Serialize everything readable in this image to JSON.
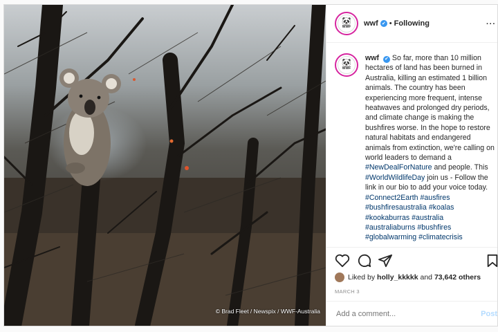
{
  "post": {
    "photo_credit": "© Brad Fleet / Newspix / WWF-Australia",
    "header": {
      "username": "wwf",
      "verified": "✔",
      "separator": "•",
      "follow_status": "Following",
      "more": "···",
      "avatar_logo": "WWF"
    },
    "caption": {
      "username": "wwf",
      "segments": [
        {
          "text": "So far, more than 10 million hectares of land has been burned in Australia, killing an estimated 1 billion animals. The country has been experiencing more frequent, intense heatwaves and prolonged dry periods, and climate change is making the bushfires worse. In the hope to restore natural habitats and endangered animals from extinction, we're calling on world leaders to demand a "
        },
        {
          "text": "#NewDealForNature",
          "tag": true
        },
        {
          "text": " and people. This "
        },
        {
          "text": "#WorldWildlifeDay",
          "tag": true
        },
        {
          "text": " join us - Follow the link in our bio to add your voice today. "
        },
        {
          "text": "#Connect2Earth",
          "tag": true
        },
        {
          "text": " "
        },
        {
          "text": "#ausfires",
          "tag": true
        },
        {
          "text": " "
        },
        {
          "text": "#bushfiresaustralia",
          "tag": true
        },
        {
          "text": " "
        },
        {
          "text": "#koalas",
          "tag": true
        },
        {
          "text": " "
        },
        {
          "text": "#kookaburras",
          "tag": true
        },
        {
          "text": " "
        },
        {
          "text": "#australia",
          "tag": true
        },
        {
          "text": " "
        },
        {
          "text": "#australiaburns",
          "tag": true
        },
        {
          "text": " "
        },
        {
          "text": "#bushfires",
          "tag": true
        },
        {
          "text": " "
        },
        {
          "text": "#globalwarming",
          "tag": true
        },
        {
          "text": " "
        },
        {
          "text": "#climatecrisis",
          "tag": true
        }
      ]
    },
    "actions": {
      "icons": [
        "heart-icon",
        "comment-icon",
        "share-icon",
        "bookmark-icon"
      ]
    },
    "likes": {
      "prefix": "Liked by",
      "user": "holly_kkkkk",
      "joiner": "and",
      "others": "73,642 others"
    },
    "date": "MARCH 3",
    "comment_box": {
      "placeholder": "Add a comment...",
      "post_label": "Post"
    },
    "colors": {
      "tag": "#00376b",
      "verified": "#3897f0",
      "post_button": "#b3dbff"
    }
  }
}
